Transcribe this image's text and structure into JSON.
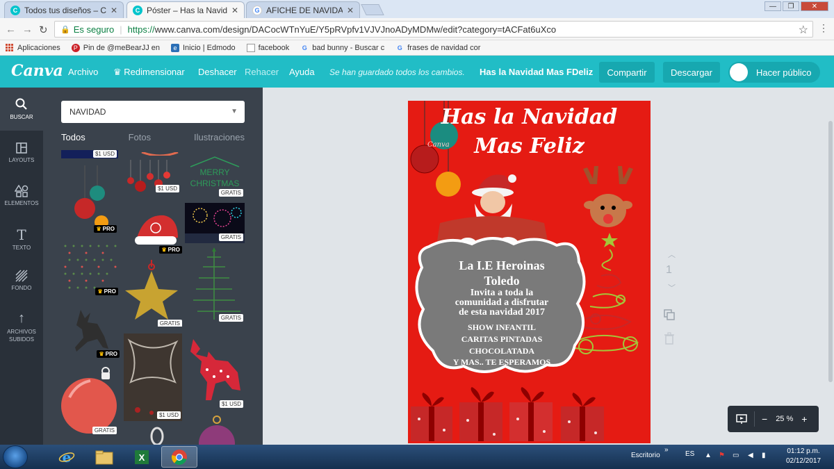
{
  "browser": {
    "tabs": [
      {
        "title": "Todos tus diseños – Canva",
        "favicon": "canva-icon",
        "active": false
      },
      {
        "title": "Póster – Has la Navidad Mas FDeliz",
        "favicon": "canva-icon",
        "active": true
      },
      {
        "title": "AFICHE DE NAVIDAD - Buscar con Google",
        "favicon": "google-icon",
        "active": false
      }
    ],
    "secure_label": "Es seguro",
    "url_scheme": "https://",
    "url_rest": "www.canva.com/design/DACocWTnYuE/Y5pRVpfv1VJVJnoADyMDMw/edit?category=tACFat6uXco",
    "bookmarks": [
      {
        "label": "Aplicaciones",
        "icon": "apps-grid-icon"
      },
      {
        "label": "Pin de @meBearJJ en",
        "icon": "pinterest-icon"
      },
      {
        "label": "Inicio | Edmodo",
        "icon": "edmodo-icon"
      },
      {
        "label": "facebook",
        "icon": "page-icon"
      },
      {
        "label": "bad bunny - Buscar c",
        "icon": "google-icon"
      },
      {
        "label": "frases de navidad cor",
        "icon": "google-icon"
      }
    ]
  },
  "canva": {
    "logo": "Canva",
    "menu": {
      "archivo": "Archivo",
      "redimensionar": "Redimensionar",
      "deshacer": "Deshacer",
      "rehacer": "Rehacer",
      "ayuda": "Ayuda"
    },
    "saved_status": "Se han guardado todos los cambios.",
    "doc_title": "Has la Navidad Mas FDeliz",
    "buttons": {
      "compartir": "Compartir",
      "descargar": "Descargar",
      "hacer_publico": "Hacer público"
    },
    "sidebar": [
      {
        "label": "BUSCAR",
        "icon": "search-icon"
      },
      {
        "label": "LAYOUTS",
        "icon": "layout-icon"
      },
      {
        "label": "ELEMENTOS",
        "icon": "shapes-icon"
      },
      {
        "label": "TEXTO",
        "icon": "text-icon"
      },
      {
        "label": "FONDO",
        "icon": "background-icon"
      },
      {
        "label": "ARCHIVOS",
        "label2": "SUBIDOS",
        "icon": "upload-icon"
      }
    ],
    "search": {
      "value": "NAVIDAD",
      "tabs": [
        "Todos",
        "Fotos",
        "Ilustraciones"
      ]
    },
    "badges": {
      "gratis": "GRATIS",
      "pro": "PRO",
      "usd": "$1 USD"
    },
    "element_texts": {
      "merry": "MERRY",
      "christmas": "CHRISTMAS",
      "watermark": "Canva"
    },
    "poster": {
      "title_line1": "Has la Navidad",
      "title_line2": "Mas Feliz",
      "school_line1": "La I.E Heroinas",
      "school_line2": "Toledo",
      "invite_line1": "Invita a toda la",
      "invite_line2": "comunidad a disfrutar",
      "invite_line3": "de esta navidad 2017",
      "events": [
        "SHOW INFANTIL",
        "CARITAS PINTADAS",
        "CHOCOLATADA",
        "Y MAS.. TE ESPERAMOS"
      ],
      "colors": {
        "background": "#e51b13",
        "plaque": "#7a7a7a",
        "tree": "#a4c639"
      }
    },
    "page_number": "1",
    "zoom": "25 %"
  },
  "taskbar": {
    "desktop_label": "Escritorio",
    "lang": "ES",
    "time": "01:12 p.m.",
    "date": "02/12/2017"
  }
}
